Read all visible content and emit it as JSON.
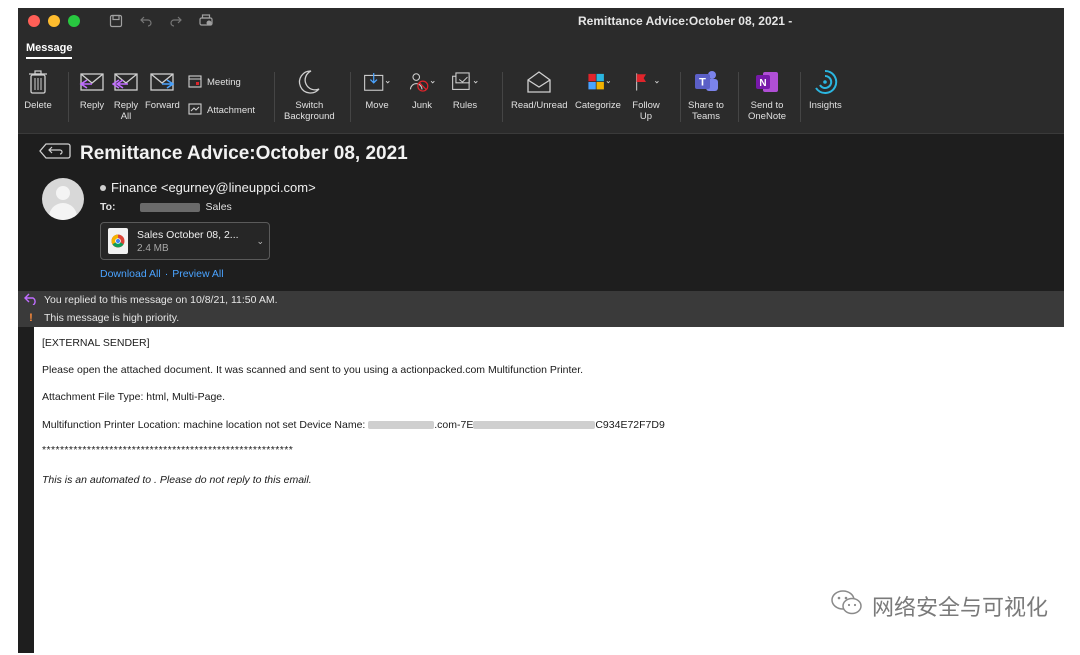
{
  "window": {
    "title": "Remittance Advice:October 08, 2021 -"
  },
  "titlebar_icons": [
    "save-icon",
    "undo-icon",
    "redo-icon",
    "print-icon"
  ],
  "ribbon": {
    "active_tab": "Message"
  },
  "toolbar": {
    "delete": "Delete",
    "reply": "Reply",
    "reply_all_1": "Reply",
    "reply_all_2": "All",
    "forward": "Forward",
    "meeting": "Meeting",
    "attachment": "Attachment",
    "switch_bg_1": "Switch",
    "switch_bg_2": "Background",
    "move": "Move",
    "junk": "Junk",
    "rules": "Rules",
    "read_unread": "Read/Unread",
    "categorize": "Categorize",
    "follow_up_1": "Follow",
    "follow_up_2": "Up",
    "share_teams_1": "Share to",
    "share_teams_2": "Teams",
    "send_onenote_1": "Send to",
    "send_onenote_2": "OneNote",
    "insights": "Insights"
  },
  "message": {
    "subject": "Remittance Advice:October 08, 2021",
    "from": "Finance <egurney@lineuppci.com>",
    "to_label": "To:",
    "to_value": "Sales",
    "attachment": {
      "name": "Sales October 08, 2...",
      "size": "2.4 MB"
    },
    "download_all": "Download All",
    "preview_all": "Preview All",
    "link_separator": "·"
  },
  "infobars": {
    "replied": "You replied to this message on 10/8/21, 11:50 AM.",
    "priority": "This message is high priority."
  },
  "body": {
    "line1": "[EXTERNAL SENDER]",
    "line2": "Please open the attached document. It was scanned and sent to you using a actionpacked.com Multifunction Printer.",
    "line3": "Attachment File Type: html, Multi-Page.",
    "line4_prefix": "Multifunction Printer Location: machine location not set Device Name:",
    "line4_mid": ".com-7E",
    "line4_suffix": "C934E72F7D9",
    "stars": "********************************************************",
    "line6": "This is an automated to . Please do not reply to this email."
  },
  "watermark": {
    "text": "网络安全与可视化"
  },
  "colors": {
    "window_bg": "#1e1e1e",
    "toolbar_bg": "#2b2b2b",
    "link": "#4aa3ff",
    "priority": "#ff8c3a",
    "teams": "#5b5fc7",
    "onenote": "#7719aa",
    "insights": "#2bb6e0",
    "flag": "#e0242b"
  }
}
